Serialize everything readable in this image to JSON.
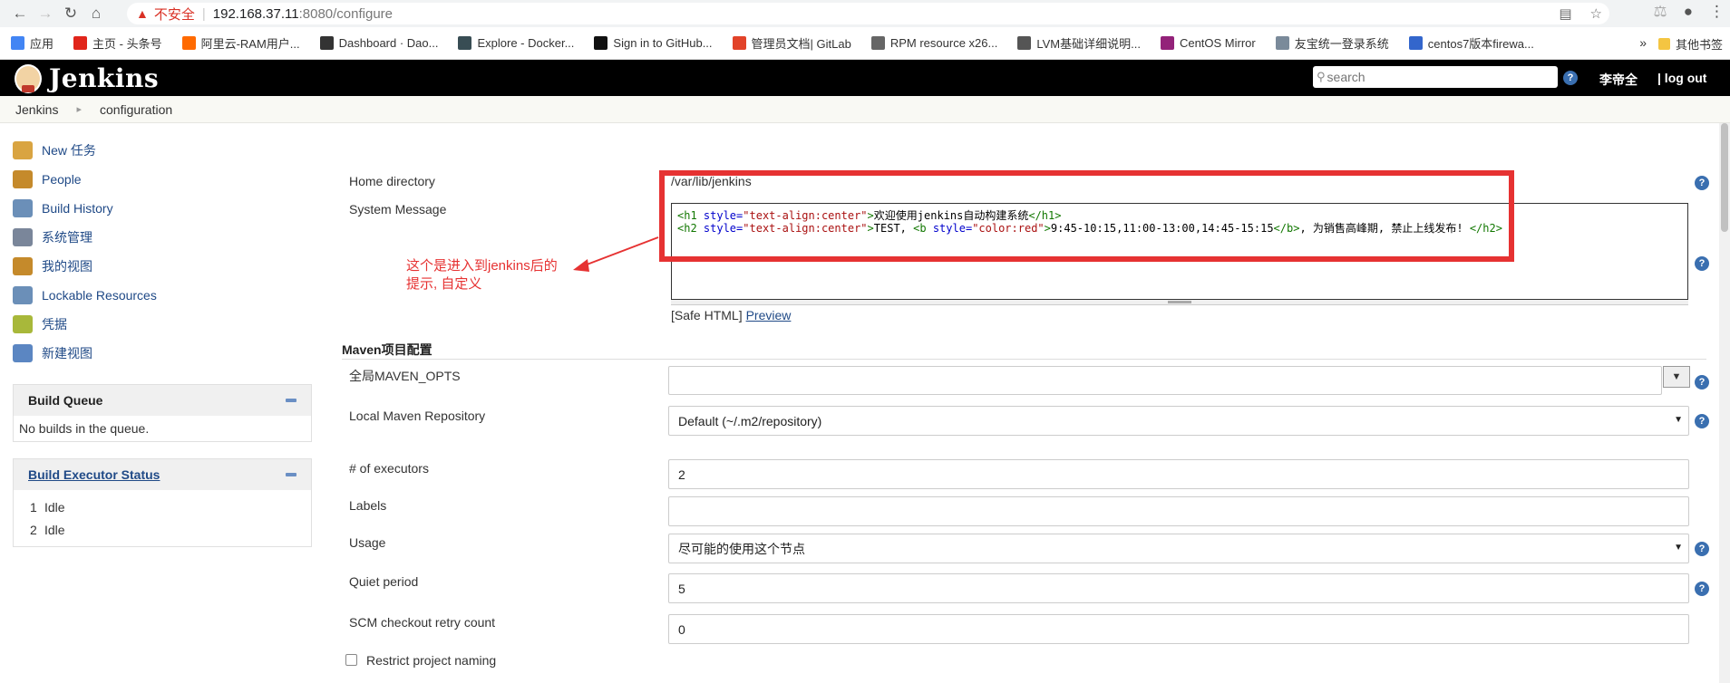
{
  "browser": {
    "insecure_label": "不安全",
    "url_host": "192.168.37.11",
    "url_rest": ":8080/configure",
    "bookmarks": [
      {
        "label": "应用",
        "color": "#4285f4"
      },
      {
        "label": "主页 - 头条号",
        "color": "#e1251b"
      },
      {
        "label": "阿里云-RAM用户...",
        "color": "#ff6a00"
      },
      {
        "label": "Dashboard · Dao...",
        "color": "#333333"
      },
      {
        "label": "Explore - Docker...",
        "color": "#384d54"
      },
      {
        "label": "Sign in to GitHub...",
        "color": "#111111"
      },
      {
        "label": "管理员文档| GitLab",
        "color": "#e24329"
      },
      {
        "label": "RPM resource x26...",
        "color": "#666666"
      },
      {
        "label": "LVM基础详细说明...",
        "color": "#555555"
      },
      {
        "label": "CentOS Mirror",
        "color": "#932279"
      },
      {
        "label": "友宝统一登录系统",
        "color": "#7a8a9a"
      },
      {
        "label": "centos7版本firewa...",
        "color": "#3366cc"
      }
    ],
    "other_bookmarks": "其他书签"
  },
  "header": {
    "logo": "Jenkins",
    "search_placeholder": "search",
    "user": "李帝全",
    "logout": "| log out"
  },
  "breadcrumb": [
    "Jenkins",
    "configuration"
  ],
  "sidebar": {
    "tasks": [
      {
        "label": "New 任务",
        "icon": "new-item-icon",
        "color": "#d9a441"
      },
      {
        "label": "People",
        "icon": "people-icon",
        "color": "#c58a2b"
      },
      {
        "label": "Build History",
        "icon": "build-history-icon",
        "color": "#6b8fb8"
      },
      {
        "label": "系统管理",
        "icon": "gear-icon",
        "color": "#7a869a"
      },
      {
        "label": "我的视图",
        "icon": "my-views-icon",
        "color": "#c58a2b"
      },
      {
        "label": "Lockable Resources",
        "icon": "lock-icon",
        "color": "#6b8fb8"
      },
      {
        "label": "凭据",
        "icon": "credentials-icon",
        "color": "#a8b83a"
      },
      {
        "label": "新建视图",
        "icon": "folder-icon",
        "color": "#5b86c2"
      }
    ],
    "build_queue": {
      "title": "Build Queue",
      "empty": "No builds in the queue."
    },
    "executor": {
      "title": "Build Executor Status",
      "rows": [
        {
          "num": "1",
          "status": "Idle"
        },
        {
          "num": "2",
          "status": "Idle"
        }
      ]
    }
  },
  "form": {
    "home_label": "Home directory",
    "home_value": "/var/lib/jenkins",
    "sysmsg_label": "System Message",
    "sysmsg_line1": {
      "t1": "<h1 ",
      "a1": "style=",
      "v1": "\"text-align:center\"",
      "t2": ">",
      "text": "欢迎使用jenkins自动构建系统",
      "t3": "</h1>"
    },
    "sysmsg_line2": {
      "t1": "<h2 ",
      "a1": "style=",
      "v1": "\"text-align:center\"",
      "t2": ">",
      "p1": "TEST, ",
      "t4": "<b ",
      "a2": "style=",
      "v2": "\"color:red\"",
      "t5": ">",
      "p2": "9:45-10:15,11:00-13:00,14:45-15:15",
      "t6": "</b>",
      "p3": ", 为销售高峰期, 禁止上线发布! ",
      "t7": "</h2>"
    },
    "safe_html": "[Safe HTML]",
    "preview": "Preview",
    "annotation_line1": "这个是进入到jenkins后的",
    "annotation_line2": "提示, 自定义",
    "maven_section": "Maven项目配置",
    "maven_opts_label": "全局MAVEN_OPTS",
    "maven_opts_value": "",
    "local_repo_label": "Local Maven Repository",
    "local_repo_value": "Default (~/.m2/repository)",
    "executors_label": "# of executors",
    "executors_value": "2",
    "labels_label": "Labels",
    "labels_value": "",
    "usage_label": "Usage",
    "usage_value": "尽可能的使用这个节点",
    "quiet_label": "Quiet period",
    "quiet_value": "5",
    "scm_label": "SCM checkout retry count",
    "scm_value": "0",
    "restrict_label": "Restrict project naming",
    "restrict_checked": false
  }
}
